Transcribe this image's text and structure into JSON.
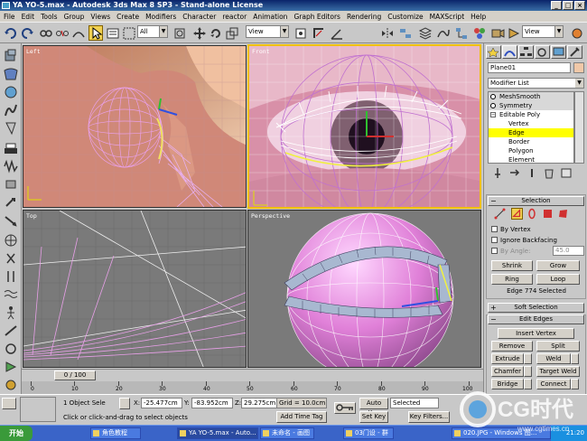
{
  "window": {
    "title": "YA YO-5.max - Autodesk 3ds Max 8 SP3 - Stand-alone License",
    "controls": [
      "_",
      "□",
      "×"
    ]
  },
  "menu": [
    "File",
    "Edit",
    "Tools",
    "Group",
    "Views",
    "Create",
    "Modifiers",
    "Character",
    "reactor",
    "Animation",
    "Graph Editors",
    "Rendering",
    "Customize",
    "MAXScript",
    "Help"
  ],
  "toolbar": {
    "selection_filter": "All",
    "ref_coord": "View",
    "named_selection": "",
    "render_view": "View"
  },
  "viewports": {
    "left": {
      "label": "Left"
    },
    "front": {
      "label": "Front"
    },
    "top": {
      "label": "Top"
    },
    "perspective": {
      "label": "Perspective"
    }
  },
  "command_panel": {
    "object_name": "Plane01",
    "modifier_list_label": "Modifier List",
    "stack": [
      {
        "label": "MeshSmooth",
        "type": "modifier"
      },
      {
        "label": "Symmetry",
        "type": "modifier"
      },
      {
        "label": "Editable Poly",
        "type": "base"
      },
      {
        "label": "Vertex",
        "type": "sub"
      },
      {
        "label": "Edge",
        "type": "sub-active"
      },
      {
        "label": "Border",
        "type": "sub"
      },
      {
        "label": "Polygon",
        "type": "sub"
      },
      {
        "label": "Element",
        "type": "sub"
      }
    ],
    "selection": {
      "title": "Selection",
      "by_vertex": "By Vertex",
      "ignore_backfacing": "Ignore Backfacing",
      "by_angle": "By Angle:",
      "angle_value": "45.0",
      "shrink": "Shrink",
      "grow": "Grow",
      "ring": "Ring",
      "loop": "Loop",
      "status": "Edge 774 Selected"
    },
    "soft_selection": {
      "title": "Soft Selection"
    },
    "edit_edges": {
      "title": "Edit Edges",
      "insert_vertex": "Insert Vertex",
      "remove": "Remove",
      "split": "Split",
      "extrude": "Extrude",
      "weld": "Weld",
      "chamfer": "Chamfer",
      "target_weld": "Target Weld",
      "bridge": "Bridge",
      "connect": "Connect"
    }
  },
  "timeline": {
    "frame_display": "0 / 100",
    "ticks": [
      "0",
      "10",
      "20",
      "30",
      "40",
      "50",
      "60",
      "70",
      "80",
      "90",
      "100"
    ]
  },
  "status": {
    "selected": "1 Object Sele",
    "x_label": "X:",
    "x_value": "-25.477cm",
    "y_label": "Y:",
    "y_value": "-83.952cm",
    "z_label": "Z:",
    "z_value": "29.275cm",
    "grid": "Grid = 10.0cm",
    "prompt": "Click or click-and-drag to select objects",
    "add_time_tag": "Add Time Tag",
    "auto_key": "Auto Key",
    "set_key": "Set Key",
    "key_mode": "Selected",
    "key_filters": "Key Filters..."
  },
  "taskbar": {
    "start": "开始",
    "tasks": [
      "角色教程",
      "YA YO-5.max - Auto...",
      "未命名 - 画图",
      "03门设 - 群",
      "020.JPG - Windows 图..."
    ],
    "clock": "21:20"
  },
  "watermark": {
    "text": "CG时代",
    "url": "www.cgtimes.cn"
  },
  "colors": {
    "active_border": "#f0c000",
    "selection_highlight": "#ffff00",
    "wire_pink": "#e8a0e8",
    "viewport_gray": "#7a7a7a",
    "taskbar_blue": "#3a64c8"
  }
}
